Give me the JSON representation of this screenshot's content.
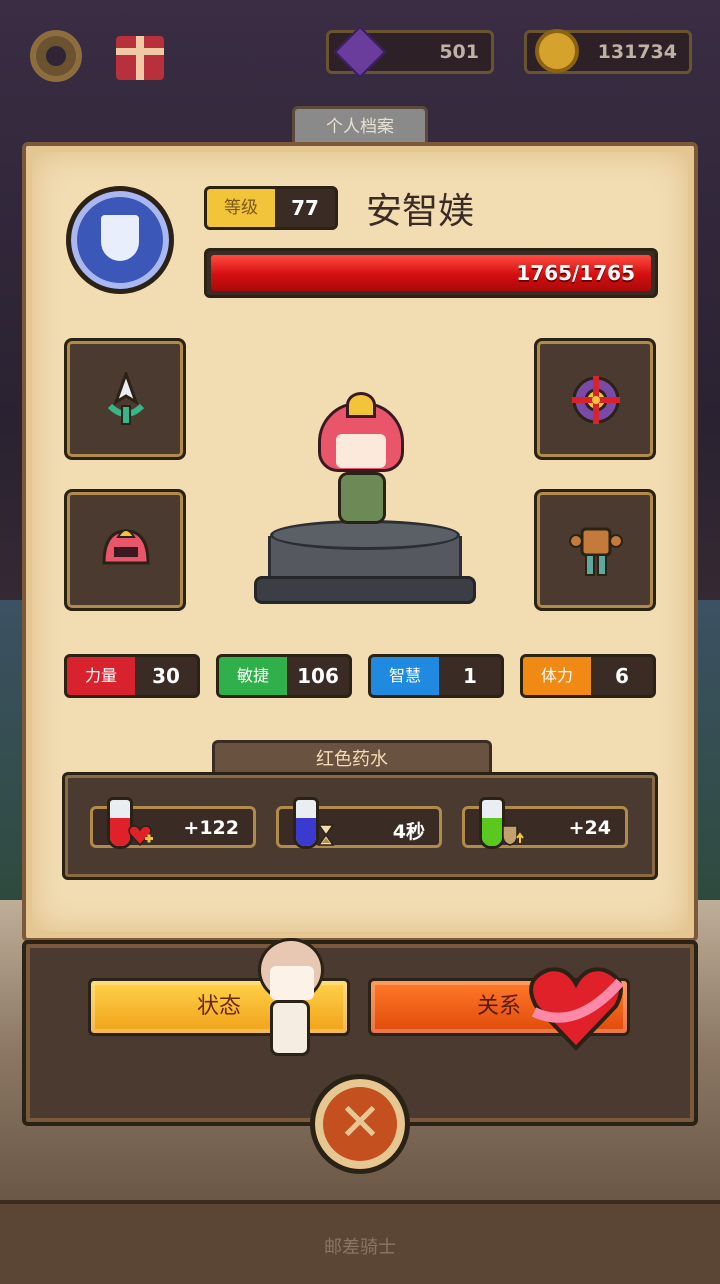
{
  "hud": {
    "gems": "501",
    "coins": "131734",
    "settings_icon": "gear-icon",
    "gift_icon": "gift-icon"
  },
  "profile_tab": "个人档案",
  "hero": {
    "level_label": "等级",
    "level": "77",
    "name": "安智媄",
    "hp_text": "1765/1765",
    "hp_fraction": 1.0
  },
  "equipment": {
    "weapon_icon": "spear-icon",
    "offhand_icon": "shield-icon",
    "helmet_icon": "helmet-icon",
    "armor_icon": "armor-icon"
  },
  "stats": [
    {
      "label": "力量",
      "value": "30",
      "color": "#d8232f"
    },
    {
      "label": "敏捷",
      "value": "106",
      "color": "#2fb04a"
    },
    {
      "label": "智慧",
      "value": "1",
      "color": "#1f8ae0"
    },
    {
      "label": "体力",
      "value": "6",
      "color": "#f08a14"
    }
  ],
  "potion": {
    "title": "红色药水",
    "items": [
      {
        "value": "+122",
        "liquid": "#e0212a",
        "icon": "heart-plus-icon"
      },
      {
        "value": "4秒",
        "liquid": "#3a3ad0",
        "icon": "hourglass-icon"
      },
      {
        "value": "+24",
        "liquid": "#5ac81e",
        "icon": "shield-up-icon"
      }
    ]
  },
  "buttons": {
    "status": "状态",
    "relation": "关系",
    "close_icon": "close-icon"
  },
  "bottom_label": "邮差骑士"
}
